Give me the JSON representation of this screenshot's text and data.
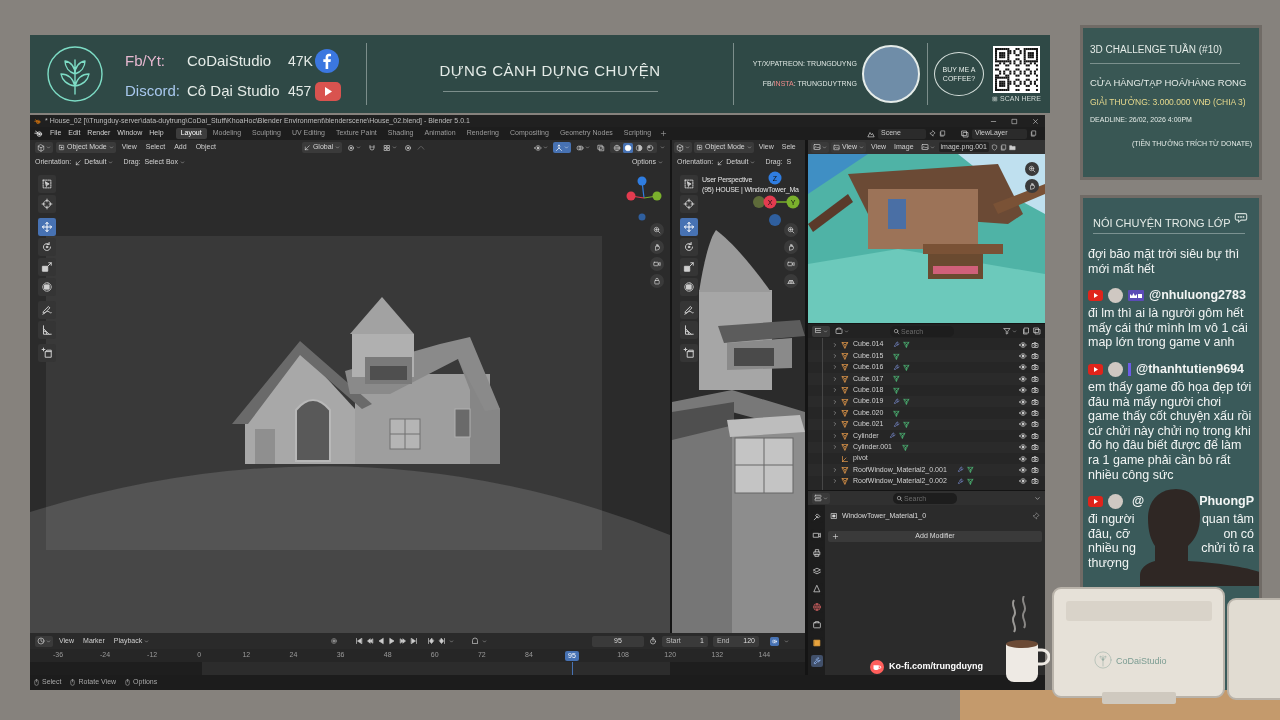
{
  "banner": {
    "socials": [
      {
        "label": "Fb/Yt:",
        "handle": "CoDaiStudio",
        "count": "47K",
        "kind": "facebook",
        "color": "#e6b8d0"
      },
      {
        "label": "Discord:",
        "handle": "Cô Dại Studio",
        "count": "457",
        "kind": "youtube",
        "color": "#a8c8ee"
      }
    ],
    "title": "DỰNG CẢNH DỰNG CHUYỆN",
    "contacts": [
      [
        {
          "text": "YT/X/PATREON: TRUNGDUYNG",
          "accent": false
        }
      ],
      [
        {
          "text": "FB/",
          "accent": false
        },
        {
          "text": "INSTA",
          "accent": true
        },
        {
          "text": ": TRUNGDUYTRNG",
          "accent": false
        }
      ]
    ],
    "bubble": "BUY ME A COFFEE?",
    "qr_caption": "SCAN HERE"
  },
  "blender": {
    "title": "* House_02 [\\\\Trungduy-server\\data-duytrung\\CoDai_Stuff\\KhoaHoc\\Blender Environment\\blenderscene\\House_02.blend] - Blender 5.0.1",
    "menus": [
      "File",
      "Edit",
      "Render",
      "Window",
      "Help"
    ],
    "workspaces": [
      {
        "label": "Layout",
        "selected": true
      },
      {
        "label": "Modeling",
        "selected": false
      },
      {
        "label": "Sculpting",
        "selected": false
      },
      {
        "label": "UV Editing",
        "selected": false
      },
      {
        "label": "Texture Paint",
        "selected": false
      },
      {
        "label": "Shading",
        "selected": false
      },
      {
        "label": "Animation",
        "selected": false
      },
      {
        "label": "Rendering",
        "selected": false
      },
      {
        "label": "Compositing",
        "selected": false
      },
      {
        "label": "Geometry Nodes",
        "selected": false
      },
      {
        "label": "Scripting",
        "selected": false
      }
    ],
    "scene": "Scene",
    "view_layer": "ViewLayer",
    "viewport": {
      "mode": "Object Mode",
      "menus": [
        "View",
        "Select",
        "Add",
        "Object"
      ],
      "orientation": "Global",
      "settings": [
        {
          "label": "Orientation:",
          "value": "Default",
          "kind": "orientation",
          "caret": true
        },
        {
          "label": "Drag:",
          "value": "Select Box",
          "kind": "drag",
          "caret": true
        }
      ],
      "options": "Options",
      "shading": [
        {
          "kind": "wireframe",
          "selected": false
        },
        {
          "kind": "solid",
          "selected": true
        },
        {
          "kind": "material",
          "selected": false
        },
        {
          "kind": "rendered",
          "selected": false
        }
      ],
      "tools": [
        [
          {
            "kind": "select_box",
            "selected": false
          },
          {
            "kind": "cursor",
            "selected": false
          }
        ],
        [
          {
            "kind": "move",
            "selected": true
          },
          {
            "kind": "rotate",
            "selected": false
          },
          {
            "kind": "scale",
            "selected": false
          },
          {
            "kind": "transform",
            "selected": false
          }
        ],
        [
          {
            "kind": "annotate",
            "selected": false
          },
          {
            "kind": "measure",
            "selected": false
          }
        ],
        [
          {
            "kind": "add_cube",
            "selected": false
          }
        ]
      ]
    },
    "viewport_2": {
      "mode": "Object Mode",
      "menus": [
        "View",
        "Sele"
      ],
      "settings": [
        {
          "label": "Orientation:",
          "value": "Default",
          "kind": "orientation",
          "caret": true
        },
        {
          "label": "Drag:",
          "value": "S",
          "kind": "drag",
          "caret": false
        }
      ],
      "info": [
        "User Perspective",
        "(95) HOUSE | WindowTower_Ma"
      ],
      "gizmo": [
        "Z",
        "X",
        "Y"
      ],
      "tools": [
        [
          {
            "kind": "select_box",
            "selected": false
          },
          {
            "kind": "cursor",
            "selected": false
          }
        ],
        [
          {
            "kind": "move",
            "selected": true
          },
          {
            "kind": "rotate",
            "selected": false
          },
          {
            "kind": "scale",
            "selected": false
          },
          {
            "kind": "transform",
            "selected": false
          }
        ],
        [
          {
            "kind": "annotate",
            "selected": false
          },
          {
            "kind": "measure",
            "selected": false
          }
        ],
        [
          {
            "kind": "add_cube",
            "selected": false
          }
        ]
      ]
    },
    "image_editor": {
      "view_mode": "View",
      "menus": [
        "View",
        "Image"
      ],
      "image": "image.png.001"
    },
    "outliner": {
      "placeholder": "Search",
      "rows": [
        {
          "name": "Cube.014",
          "kind": "mesh",
          "modifier": true
        },
        {
          "name": "Cube.015",
          "kind": "mesh",
          "modifier": false
        },
        {
          "name": "Cube.016",
          "kind": "mesh",
          "modifier": true
        },
        {
          "name": "Cube.017",
          "kind": "mesh",
          "modifier": false
        },
        {
          "name": "Cube.018",
          "kind": "mesh",
          "modifier": false
        },
        {
          "name": "Cube.019",
          "kind": "mesh",
          "modifier": true
        },
        {
          "name": "Cube.020",
          "kind": "mesh",
          "modifier": false
        },
        {
          "name": "Cube.021",
          "kind": "mesh",
          "modifier": true
        },
        {
          "name": "Cylinder",
          "kind": "mesh",
          "modifier": true
        },
        {
          "name": "Cylinder.001",
          "kind": "mesh",
          "modifier": false
        },
        {
          "name": "pivot",
          "kind": "empty",
          "modifier": false
        },
        {
          "name": "RoofWindow_Material2_0.001",
          "kind": "mesh",
          "modifier": true
        },
        {
          "name": "RoofWindow_Material2_0.002",
          "kind": "mesh",
          "modifier": true
        }
      ]
    },
    "properties": {
      "placeholder": "Search",
      "tabs": [
        {
          "kind": "tool",
          "selected": false
        },
        {
          "kind": "render",
          "selected": false
        },
        {
          "kind": "output",
          "selected": false
        },
        {
          "kind": "view_layer",
          "selected": false
        },
        {
          "kind": "scene",
          "selected": false
        },
        {
          "kind": "world",
          "selected": false
        },
        {
          "kind": "collection",
          "selected": false
        },
        {
          "kind": "object",
          "selected": false
        },
        {
          "kind": "modifier",
          "selected": true
        }
      ],
      "object": "WindowTower_Material1_0",
      "button": "Add Modifier"
    },
    "timeline": {
      "menus": [
        "View",
        "Marker"
      ],
      "playback": "Playback",
      "current_frame": "95",
      "start_label": "Start",
      "start": "1",
      "end_label": "End",
      "end": "120",
      "ruler": [
        {
          "label": "-36",
          "selected": false
        },
        {
          "label": "-24",
          "selected": false
        },
        {
          "label": "-12",
          "selected": false
        },
        {
          "label": "0",
          "selected": false
        },
        {
          "label": "12",
          "selected": false
        },
        {
          "label": "24",
          "selected": false
        },
        {
          "label": "36",
          "selected": false
        },
        {
          "label": "48",
          "selected": false
        },
        {
          "label": "60",
          "selected": false
        },
        {
          "label": "72",
          "selected": false
        },
        {
          "label": "84",
          "selected": false
        },
        {
          "label": "95",
          "selected": true
        },
        {
          "label": "108",
          "selected": false
        },
        {
          "label": "120",
          "selected": false
        },
        {
          "label": "132",
          "selected": false
        },
        {
          "label": "144",
          "selected": false
        }
      ]
    },
    "status": [
      "Select",
      "Rotate View",
      "Options"
    ]
  },
  "challenge": {
    "title": "3D CHALLENGE TUẦN (#10)",
    "lines": [
      {
        "kind": "topic",
        "text": "CỬA HÀNG/TẠP HOÁ/HÀNG RONG"
      },
      {
        "kind": "prize",
        "text": "GIẢI THƯỞNG: 3.000.000 VNĐ (CHIA 3)"
      },
      {
        "kind": "deadline",
        "text": "DEADLINE: 26/02, 2026 4:00PM"
      },
      {
        "kind": "note",
        "text": "(TIỀN THƯỞNG TRÍCH TỪ DONATE)"
      }
    ]
  },
  "chat": {
    "title": "NÓI CHUYỆN TRONG LỚP",
    "messages": [
      {
        "kind": "continued",
        "text": "đợi bão mặt trời siêu bự thì mới mất hết"
      },
      {
        "kind": "full",
        "author": "@nhuluong2783",
        "badge": {
          "kind": "member"
        },
        "text": "đi lm thì ai là người gôm hết mấy cái thứ mình lm vô 1 cái map lớn trong game v anh"
      },
      {
        "kind": "full",
        "author": "@thanhtutien9694",
        "badge": {
          "kind": "bar"
        },
        "text": "em thấy game đồ họa đẹp tới đâu mà mấy người chơi game thấy cốt chuyện xấu rồi cứ chửi này chửi nọ trong khi đó họ đâu biết được để làm ra 1 game phải cần bỏ rất nhiều công sức"
      },
      {
        "kind": "covered",
        "author_parts": [
          "@",
          "PhuongP"
        ],
        "lines": [
          [
            "đi người",
            "quan tâm"
          ],
          [
            "đâu, cỡ",
            "on có"
          ],
          [
            "nhiều ng",
            "chửi tỏ ra"
          ],
          [
            "thượng"
          ]
        ]
      }
    ]
  },
  "overlay": {
    "kofi": "Ko-fi.com/trungduyng",
    "monitor_logo": "CoDaiStudio"
  }
}
